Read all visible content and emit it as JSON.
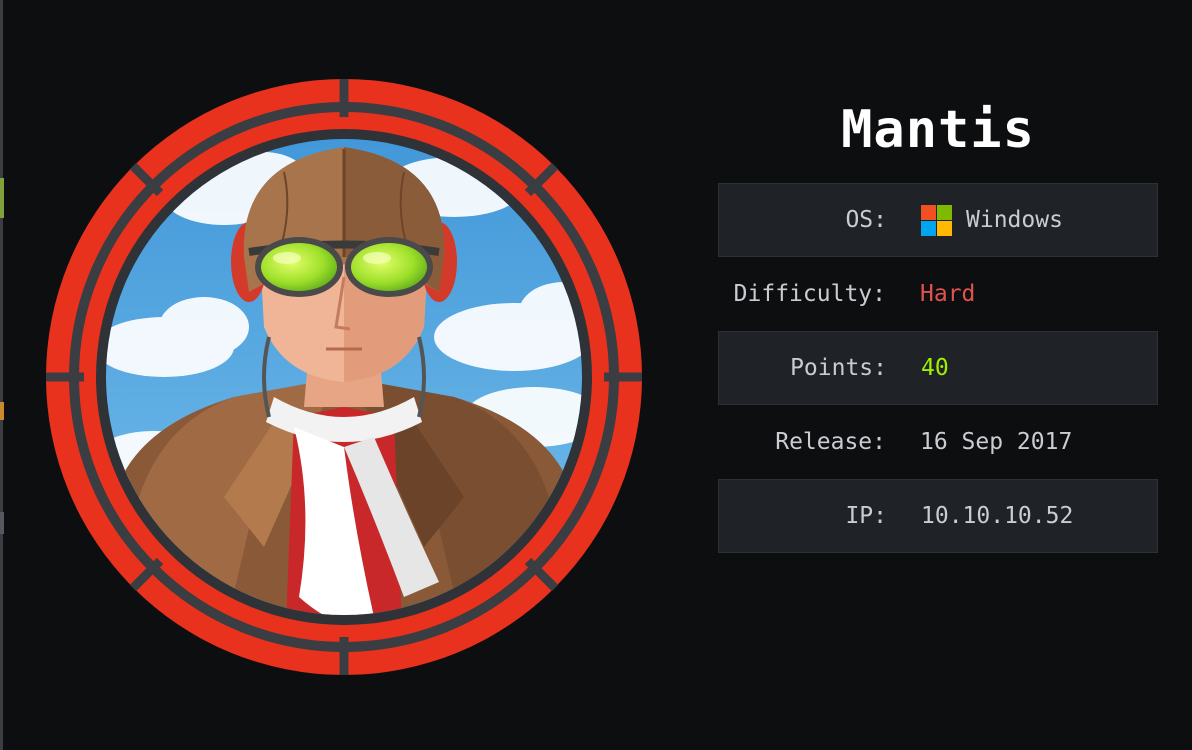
{
  "machine": {
    "name": "Mantis"
  },
  "info": {
    "os_label": "OS:",
    "os_value": "Windows",
    "os_icon": "windows-logo-icon",
    "difficulty_label": "Difficulty:",
    "difficulty_value": "Hard",
    "points_label": "Points:",
    "points_value": "40",
    "release_label": "Release:",
    "release_value": "16 Sep 2017",
    "ip_label": "IP:",
    "ip_value": "10.10.10.52"
  },
  "colors": {
    "background": "#0d0e10",
    "difficulty_hard": "#e0524c",
    "points": "#9fef00",
    "ring_red": "#e8321e",
    "text": "#c9ccd1"
  }
}
